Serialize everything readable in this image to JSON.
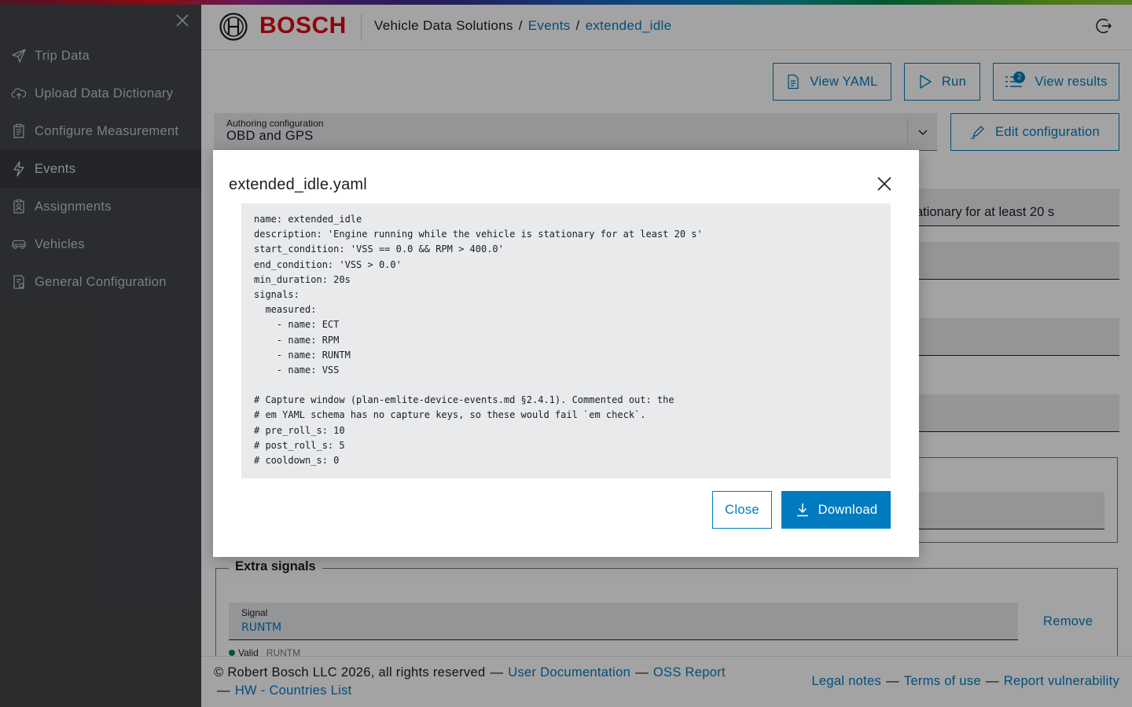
{
  "sidebar": {
    "items": [
      {
        "label": "Trip Data",
        "icon": "send-icon"
      },
      {
        "label": "Upload Data Dictionary",
        "icon": "cloud-upload-icon"
      },
      {
        "label": "Configure Measurement",
        "icon": "clipboard-icon"
      },
      {
        "label": "Events",
        "icon": "lightning-icon",
        "active": true
      },
      {
        "label": "Assignments",
        "icon": "clipboard-person-icon"
      },
      {
        "label": "Vehicles",
        "icon": "car-icon"
      },
      {
        "label": "General Configuration",
        "icon": "document-settings-icon"
      }
    ]
  },
  "header": {
    "brand": "BOSCH",
    "breadcrumb": {
      "root": "Vehicle Data Solutions",
      "sep": "/",
      "section": "Events",
      "current": "extended_idle"
    }
  },
  "toolbar": {
    "view_yaml": "View YAML",
    "run": "Run",
    "view_results": "View results",
    "results_badge": "2",
    "edit_configuration": "Edit configuration"
  },
  "authoring": {
    "label": "Authoring configuration",
    "value": "OBD and GPS"
  },
  "description_fragment": "ationary for at least 20 s",
  "extra_signals": {
    "legend": "Extra signals",
    "signal_label": "Signal",
    "signal_value": "RUNTM",
    "remove": "Remove",
    "valid_text": "Valid",
    "valid_sub": "RUNTM"
  },
  "footer": {
    "copyright": "© Robert Bosch LLC 2026, all rights reserved",
    "dash": "—",
    "user_documentation": "User Documentation",
    "oss_report": "OSS Report",
    "hw_countries": "HW - Countries List",
    "legal_notes": "Legal notes",
    "terms_of_use": "Terms of use",
    "report_vulnerability": "Report vulnerability"
  },
  "dialog": {
    "title": "extended_idle.yaml",
    "close_label": "Close",
    "download_label": "Download",
    "lines": [
      "name: extended_idle",
      "description: 'Engine running while the vehicle is stationary for at least 20 s'",
      "start_condition: 'VSS == 0.0 && RPM > 400.0'",
      "end_condition: 'VSS > 0.0'",
      "min_duration: 20s",
      "signals:",
      "  measured:",
      "    - name: ECT",
      "    - name: RPM",
      "    - name: RUNTM",
      "    - name: VSS",
      "",
      "# Capture window (plan-emlite-device-events.md §2.4.1). Commented out: the",
      "# em YAML schema has no capture keys, so these would fail `em check`.",
      "# pre_roll_s: 10",
      "# post_roll_s: 5",
      "# cooldown_s: 0"
    ]
  },
  "colors": {
    "accent": "#007bc0",
    "brand_red": "#e20015",
    "sidebar_bg": "#43464a",
    "valid_green": "#00884a"
  }
}
